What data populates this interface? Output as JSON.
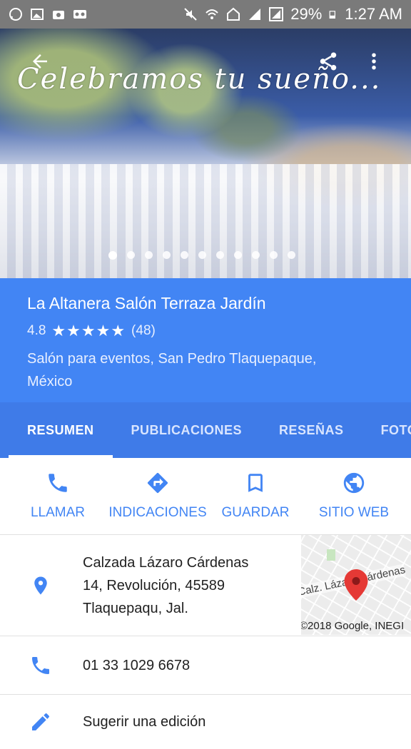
{
  "status_bar": {
    "battery": "29%",
    "time": "1:27 AM",
    "icons_left": [
      "whatsapp-icon",
      "image-icon",
      "camera-icon",
      "voicemail-icon"
    ],
    "icons_right": [
      "mute-icon",
      "wifi-icon",
      "nfc-icon",
      "signal-icon",
      "signal-icon",
      "battery-icon"
    ]
  },
  "hero": {
    "caption": "Celebramos tu sueño...",
    "photo_count": 11,
    "active_photo_index": 0
  },
  "place": {
    "name": "La Altanera Salón Terraza Jardín",
    "rating": "4.8",
    "stars": "★★★★★",
    "review_count": "(48)",
    "category_line": "Salón para eventos, San Pedro Tlaquepaque, México"
  },
  "tabs": [
    "RESUMEN",
    "PUBLICACIONES",
    "RESEÑAS",
    "FOTOS"
  ],
  "active_tab": "RESUMEN",
  "actions": {
    "call": "LLAMAR",
    "directions": "INDICACIONES",
    "save": "GUARDAR",
    "website": "SITIO WEB"
  },
  "address": {
    "line1": "Calzada Lázaro Cárdenas",
    "line2": "14, Revolución, 45589",
    "line3": "Tlaquepaqu, Jal."
  },
  "map_thumb": {
    "street_label": "Calz. Lázaro Cárdenas",
    "credit": "©2018 Google, INEGI"
  },
  "phone": "01 33 1029 6678",
  "suggest_edit": "Sugerir una edición",
  "colors": {
    "accent": "#4285f4",
    "tab_bar": "#3f7be8",
    "status_bar": "#7a7a7a",
    "pin": "#e53935"
  }
}
